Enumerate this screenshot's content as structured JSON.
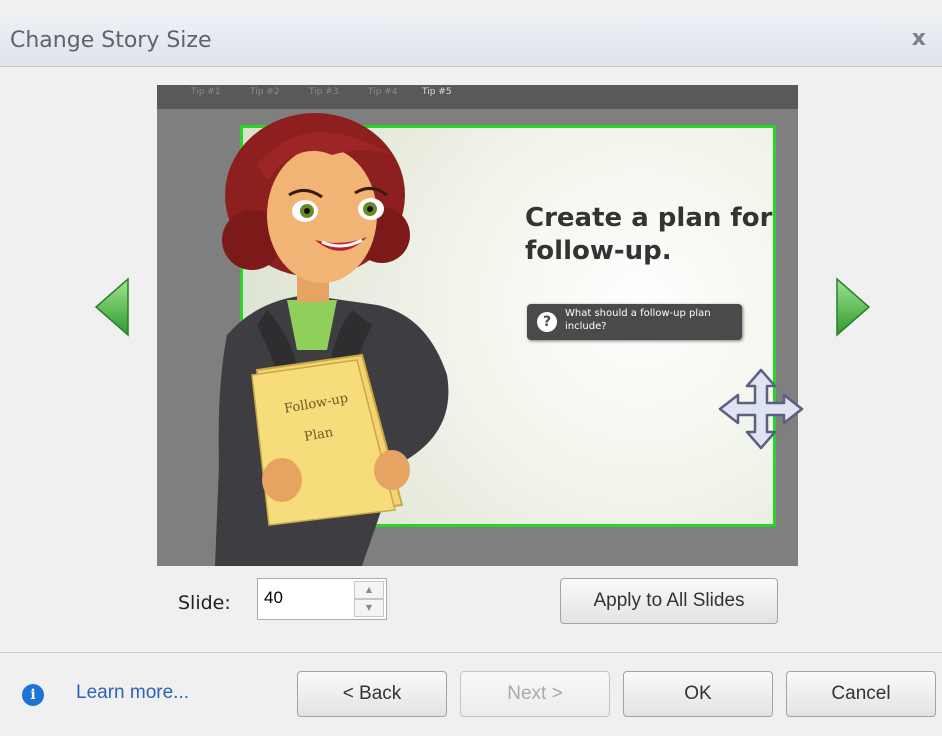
{
  "dialog": {
    "title": "Change Story Size",
    "close_label": "x"
  },
  "preview": {
    "slide_tabs": [
      "Tip #1",
      "Tip #2",
      "Tip #3",
      "Tip #4",
      "Tip #5"
    ],
    "heading": "Create a plan for follow-up.",
    "tip_button": "What should a follow-up plan include?",
    "folder_text": [
      "Follow-up",
      "Plan"
    ],
    "crop_color": "#28d428"
  },
  "controls": {
    "slide_label": "Slide:",
    "slide_value": "40",
    "apply_all": "Apply to All Slides"
  },
  "footer": {
    "learn_more": "Learn more...",
    "back": "< Back",
    "next": "Next >",
    "ok": "OK",
    "cancel": "Cancel"
  },
  "icons": [
    "info-icon",
    "prev-arrow-icon",
    "next-arrow-icon",
    "move-cursor-icon",
    "close-icon",
    "spin-up-icon",
    "spin-down-icon"
  ]
}
